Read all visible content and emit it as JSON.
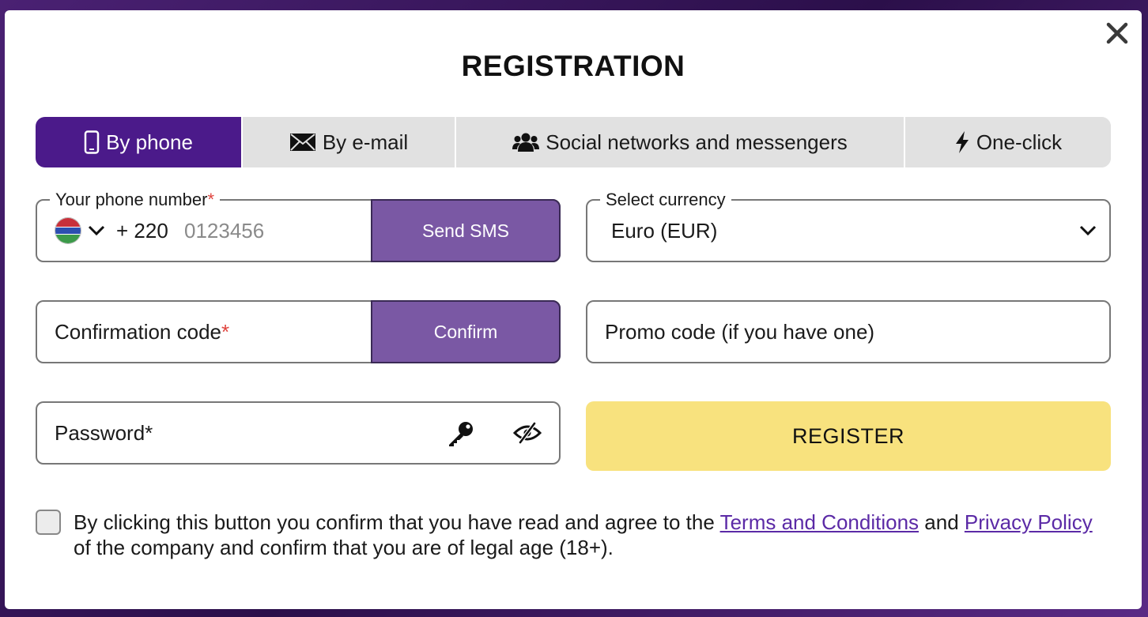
{
  "dialog": {
    "title": "REGISTRATION",
    "close_icon": "close-icon"
  },
  "tabs": [
    {
      "label": "By phone",
      "icon": "phone-icon",
      "active": true
    },
    {
      "label": "By e-mail",
      "icon": "envelope-icon",
      "active": false
    },
    {
      "label": "Social networks and messengers",
      "icon": "users-icon",
      "active": false
    },
    {
      "label": "One-click",
      "icon": "lightning-icon",
      "active": false
    }
  ],
  "phone": {
    "label": "Your phone number",
    "required_mark": "*",
    "country_flag": "gambia-flag",
    "dial_code": "+ 220",
    "placeholder": "0123456",
    "send_sms_label": "Send SMS"
  },
  "currency": {
    "label": "Select currency",
    "selected": "Euro (EUR)"
  },
  "confirmation": {
    "placeholder": "Confirmation code",
    "required_mark": "*",
    "confirm_label": "Confirm"
  },
  "promo": {
    "placeholder": "Promo code (if you have one)"
  },
  "password": {
    "placeholder": "Password*",
    "key_icon": "key-icon",
    "visibility_icon": "eye-slash-icon"
  },
  "register": {
    "label": "REGISTER"
  },
  "agreement": {
    "checked": false,
    "text_before": "By clicking this button you confirm that you have read and agree to the ",
    "terms_link": "Terms and Conditions",
    "text_middle": " and ",
    "privacy_link": "Privacy Policy",
    "text_after": " of the company and confirm that you are of legal age (18+)."
  },
  "colors": {
    "tab_active": "#4b1a8a",
    "side_button": "#7a58a4",
    "register_button": "#f8e27e",
    "required": "#e0443e",
    "link": "#5b2aa6"
  }
}
